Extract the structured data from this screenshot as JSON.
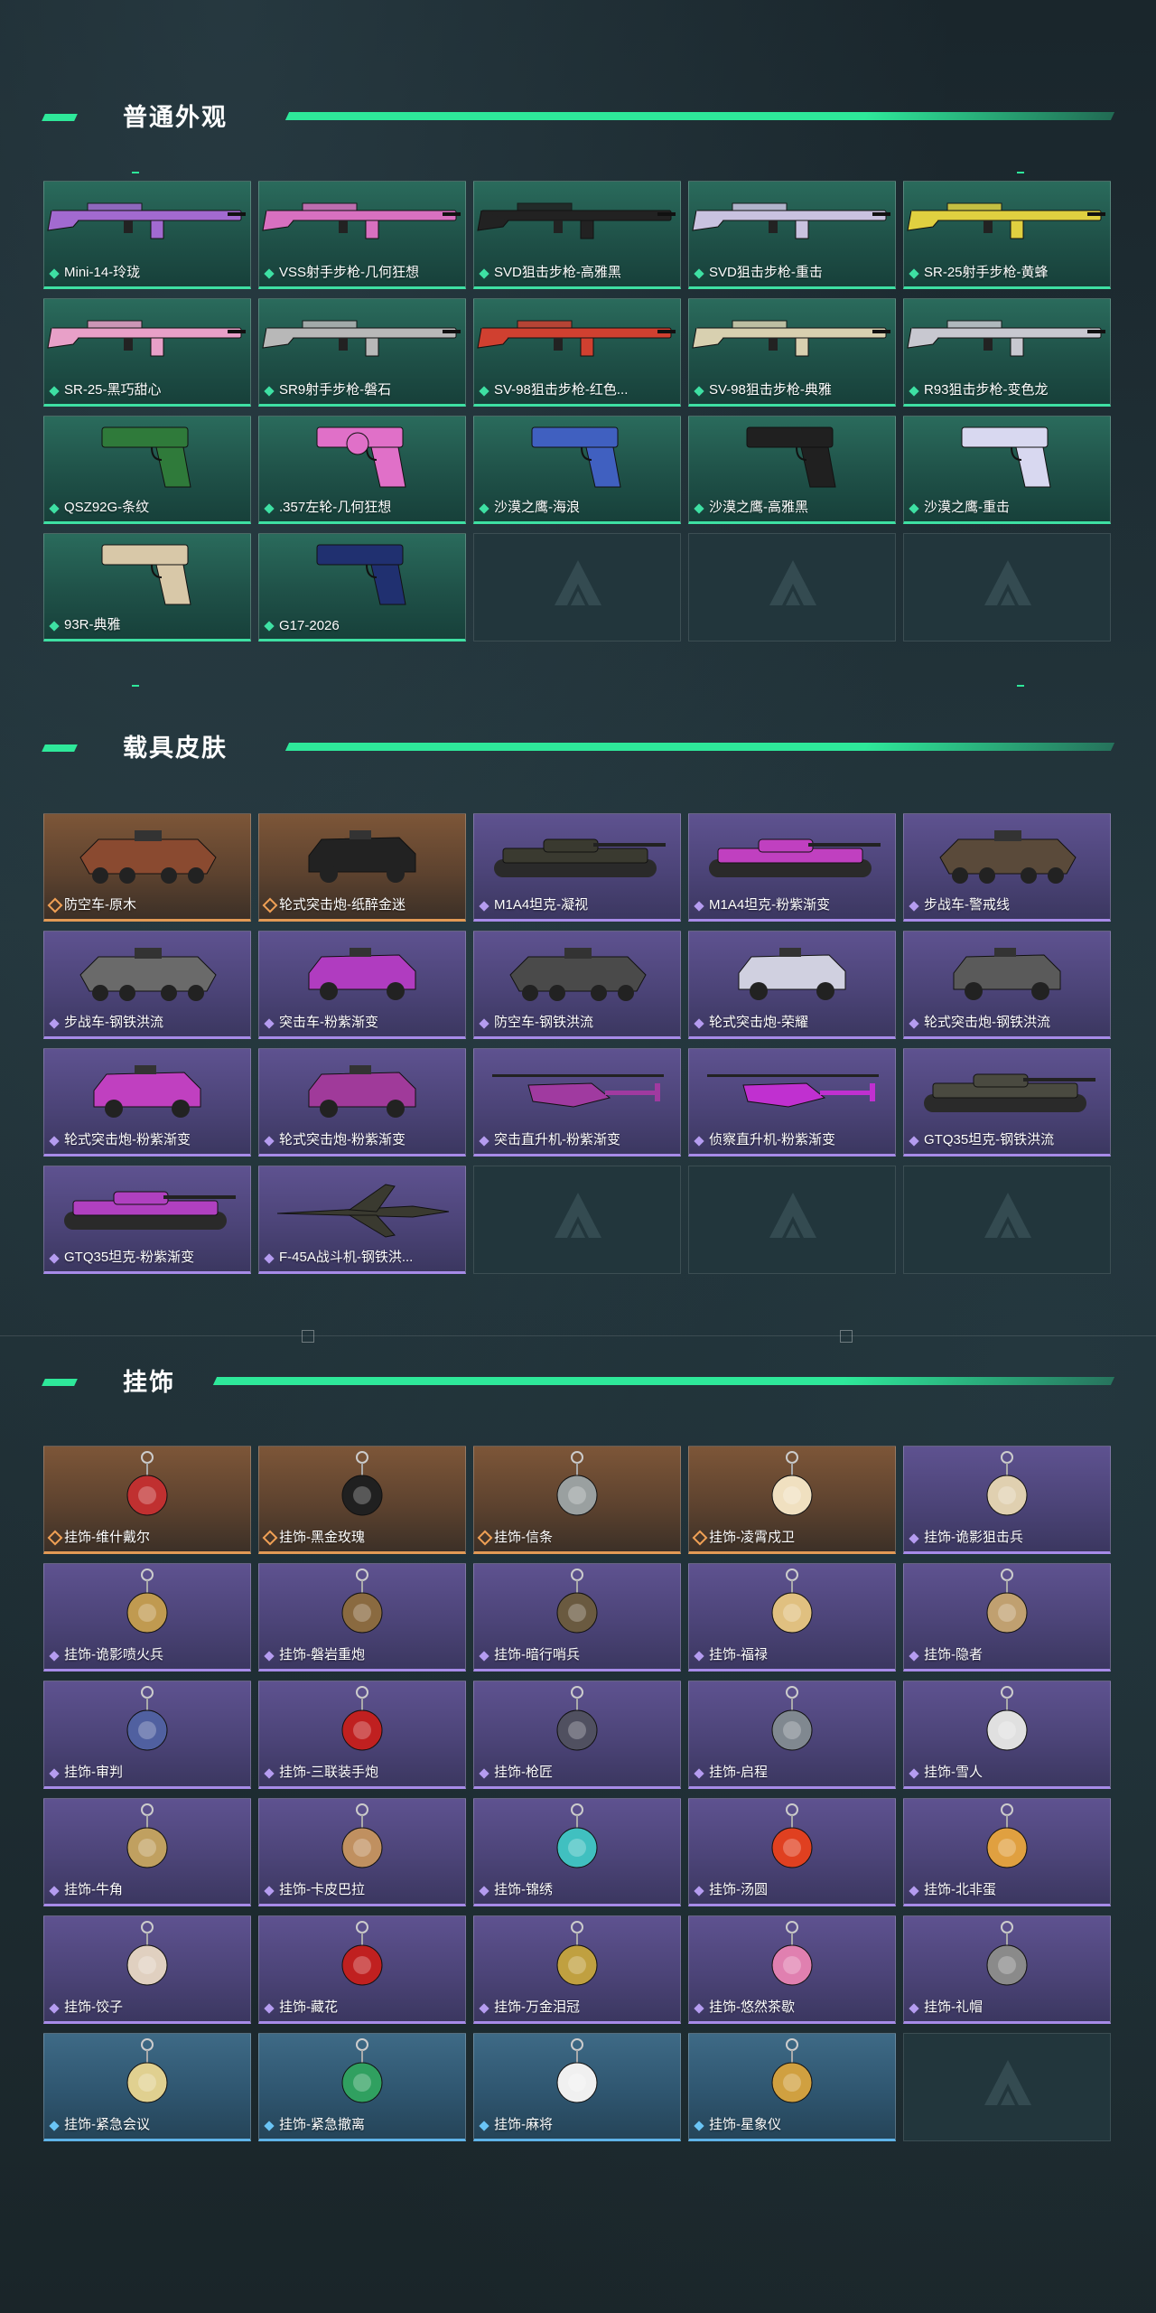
{
  "colors": {
    "accent": "#2ee89a",
    "green_rarity": "#3ee0a3",
    "orange_rarity": "#e29a55",
    "purple_rarity": "#a78be8",
    "blue_rarity": "#5fb3e8"
  },
  "sections": [
    {
      "title": "普通外观",
      "items": [
        {
          "label": "Mini-14-玲珑",
          "rarity": "green",
          "kind": "rifle",
          "tint": "#a26ad0"
        },
        {
          "label": "VSS射手步枪-几何狂想",
          "rarity": "green",
          "kind": "rifle",
          "tint": "#d870c0"
        },
        {
          "label": "SVD狙击步枪-高雅黑",
          "rarity": "green",
          "kind": "rifle",
          "tint": "#222222"
        },
        {
          "label": "SVD狙击步枪-重击",
          "rarity": "green",
          "kind": "rifle",
          "tint": "#c9c2e0"
        },
        {
          "label": "SR-25射手步枪-黄蜂",
          "rarity": "green",
          "kind": "rifle",
          "tint": "#e0d040"
        },
        {
          "label": "SR-25-黑巧甜心",
          "rarity": "green",
          "kind": "rifle",
          "tint": "#e8a0c8"
        },
        {
          "label": "SR9射手步枪-磐石",
          "rarity": "green",
          "kind": "rifle",
          "tint": "#b8b8b8"
        },
        {
          "label": "SV-98狙击步枪-红色...",
          "rarity": "green",
          "kind": "rifle",
          "tint": "#d04030"
        },
        {
          "label": "SV-98狙击步枪-典雅",
          "rarity": "green",
          "kind": "rifle",
          "tint": "#d8d0b0"
        },
        {
          "label": "R93狙击步枪-变色龙",
          "rarity": "green",
          "kind": "rifle",
          "tint": "#c8c8d0"
        },
        {
          "label": "QSZ92G-条纹",
          "rarity": "green",
          "kind": "pistol",
          "tint": "#2f7a3a"
        },
        {
          "label": ".357左轮-几何狂想",
          "rarity": "green",
          "kind": "revolver",
          "tint": "#e070c8"
        },
        {
          "label": "沙漠之鹰-海浪",
          "rarity": "green",
          "kind": "pistol",
          "tint": "#4060c0"
        },
        {
          "label": "沙漠之鹰-高雅黑",
          "rarity": "green",
          "kind": "pistol",
          "tint": "#202020"
        },
        {
          "label": "沙漠之鹰-重击",
          "rarity": "green",
          "kind": "pistol",
          "tint": "#d8d8f0"
        },
        {
          "label": "93R-典雅",
          "rarity": "green",
          "kind": "pistol",
          "tint": "#d8c8a8"
        },
        {
          "label": "G17-2026",
          "rarity": "green",
          "kind": "pistol",
          "tint": "#203070"
        },
        {
          "label": "",
          "rarity": "empty"
        },
        {
          "label": "",
          "rarity": "empty"
        },
        {
          "label": "",
          "rarity": "empty"
        }
      ]
    },
    {
      "title": "载具皮肤",
      "items": [
        {
          "label": "防空车-原木",
          "rarity": "orange",
          "kind": "apc",
          "tint": "#8a4a30"
        },
        {
          "label": "轮式突击炮-纸醉金迷",
          "rarity": "orange",
          "kind": "truck",
          "tint": "#222222"
        },
        {
          "label": "M1A4坦克-凝视",
          "rarity": "purple",
          "kind": "tank",
          "tint": "#3a3a30"
        },
        {
          "label": "M1A4坦克-粉紫渐变",
          "rarity": "purple",
          "kind": "tank",
          "tint": "#c040c0"
        },
        {
          "label": "步战车-警戒线",
          "rarity": "purple",
          "kind": "apc",
          "tint": "#5a4a3a"
        },
        {
          "label": "步战车-钢铁洪流",
          "rarity": "purple",
          "kind": "apc",
          "tint": "#6a6a6a"
        },
        {
          "label": "突击车-粉紫渐变",
          "rarity": "purple",
          "kind": "truck",
          "tint": "#b03cc0"
        },
        {
          "label": "防空车-钢铁洪流",
          "rarity": "purple",
          "kind": "apc",
          "tint": "#4a4a4a"
        },
        {
          "label": "轮式突击炮-荣耀",
          "rarity": "purple",
          "kind": "truck",
          "tint": "#d0d0e0"
        },
        {
          "label": "轮式突击炮-钢铁洪流",
          "rarity": "purple",
          "kind": "truck",
          "tint": "#5a5a5a"
        },
        {
          "label": "轮式突击炮-粉紫渐变",
          "rarity": "purple",
          "kind": "truck",
          "tint": "#c040c0"
        },
        {
          "label": "轮式突击炮-粉紫渐变",
          "rarity": "purple",
          "kind": "truck",
          "tint": "#a03a9a"
        },
        {
          "label": "突击直升机-粉紫渐变",
          "rarity": "purple",
          "kind": "heli",
          "tint": "#a03aa0"
        },
        {
          "label": "侦察直升机-粉紫渐变",
          "rarity": "purple",
          "kind": "heli",
          "tint": "#c030d0"
        },
        {
          "label": "GTQ35坦克-钢铁洪流",
          "rarity": "purple",
          "kind": "tank",
          "tint": "#4a4a40"
        },
        {
          "label": "GTQ35坦克-粉紫渐变",
          "rarity": "purple",
          "kind": "tank",
          "tint": "#b040c0"
        },
        {
          "label": "F-45A战斗机-钢铁洪...",
          "rarity": "purple",
          "kind": "jet",
          "tint": "#3a3a30"
        },
        {
          "label": "",
          "rarity": "empty"
        },
        {
          "label": "",
          "rarity": "empty"
        },
        {
          "label": "",
          "rarity": "empty"
        }
      ]
    },
    {
      "title": "挂饰",
      "items": [
        {
          "label": "挂饰-维什戴尔",
          "rarity": "orange",
          "kind": "charm",
          "tint": "#c03030"
        },
        {
          "label": "挂饰-黑金玫瑰",
          "rarity": "orange",
          "kind": "charm",
          "tint": "#202020"
        },
        {
          "label": "挂饰-信条",
          "rarity": "orange",
          "kind": "charm",
          "tint": "#9aa0a0"
        },
        {
          "label": "挂饰-凌霄戍卫",
          "rarity": "orange",
          "kind": "charm",
          "tint": "#f0e0c0"
        },
        {
          "label": "挂饰-诡影狙击兵",
          "rarity": "purple",
          "kind": "charm",
          "tint": "#e0d0b0"
        },
        {
          "label": "挂饰-诡影喷火兵",
          "rarity": "purple",
          "kind": "charm",
          "tint": "#c09a50"
        },
        {
          "label": "挂饰-磐岩重炮",
          "rarity": "purple",
          "kind": "charm",
          "tint": "#8a6a40"
        },
        {
          "label": "挂饰-暗行哨兵",
          "rarity": "purple",
          "kind": "charm",
          "tint": "#6a5a40"
        },
        {
          "label": "挂饰-福禄",
          "rarity": "purple",
          "kind": "charm",
          "tint": "#e0c080"
        },
        {
          "label": "挂饰-隐者",
          "rarity": "purple",
          "kind": "charm",
          "tint": "#c0a070"
        },
        {
          "label": "挂饰-审判",
          "rarity": "purple",
          "kind": "charm",
          "tint": "#5060a0"
        },
        {
          "label": "挂饰-三联装手炮",
          "rarity": "purple",
          "kind": "charm",
          "tint": "#c02020"
        },
        {
          "label": "挂饰-枪匠",
          "rarity": "purple",
          "kind": "charm",
          "tint": "#505060"
        },
        {
          "label": "挂饰-启程",
          "rarity": "purple",
          "kind": "charm",
          "tint": "#808890"
        },
        {
          "label": "挂饰-雪人",
          "rarity": "purple",
          "kind": "charm",
          "tint": "#e0e0e0"
        },
        {
          "label": "挂饰-牛角",
          "rarity": "purple",
          "kind": "charm",
          "tint": "#c0a060"
        },
        {
          "label": "挂饰-卡皮巴拉",
          "rarity": "purple",
          "kind": "charm",
          "tint": "#c09060"
        },
        {
          "label": "挂饰-锦绣",
          "rarity": "purple",
          "kind": "charm",
          "tint": "#40c0c0"
        },
        {
          "label": "挂饰-汤圆",
          "rarity": "purple",
          "kind": "charm",
          "tint": "#e04020"
        },
        {
          "label": "挂饰-北非蛋",
          "rarity": "purple",
          "kind": "charm",
          "tint": "#e0a040"
        },
        {
          "label": "挂饰-饺子",
          "rarity": "purple",
          "kind": "charm",
          "tint": "#e0d0c0"
        },
        {
          "label": "挂饰-藏花",
          "rarity": "purple",
          "kind": "charm",
          "tint": "#c02020"
        },
        {
          "label": "挂饰-万金泪冠",
          "rarity": "purple",
          "kind": "charm",
          "tint": "#c0a040"
        },
        {
          "label": "挂饰-悠然茶歇",
          "rarity": "purple",
          "kind": "charm",
          "tint": "#e080b0"
        },
        {
          "label": "挂饰-礼帽",
          "rarity": "purple",
          "kind": "charm",
          "tint": "#8a8a8a"
        },
        {
          "label": "挂饰-紧急会议",
          "rarity": "blue",
          "kind": "charm",
          "tint": "#e0d090"
        },
        {
          "label": "挂饰-紧急撤离",
          "rarity": "blue",
          "kind": "charm",
          "tint": "#30a060"
        },
        {
          "label": "挂饰-麻将",
          "rarity": "blue",
          "kind": "charm",
          "tint": "#f0f0f0"
        },
        {
          "label": "挂饰-星象仪",
          "rarity": "blue",
          "kind": "charm",
          "tint": "#d0a040"
        },
        {
          "label": "",
          "rarity": "empty"
        }
      ]
    }
  ]
}
